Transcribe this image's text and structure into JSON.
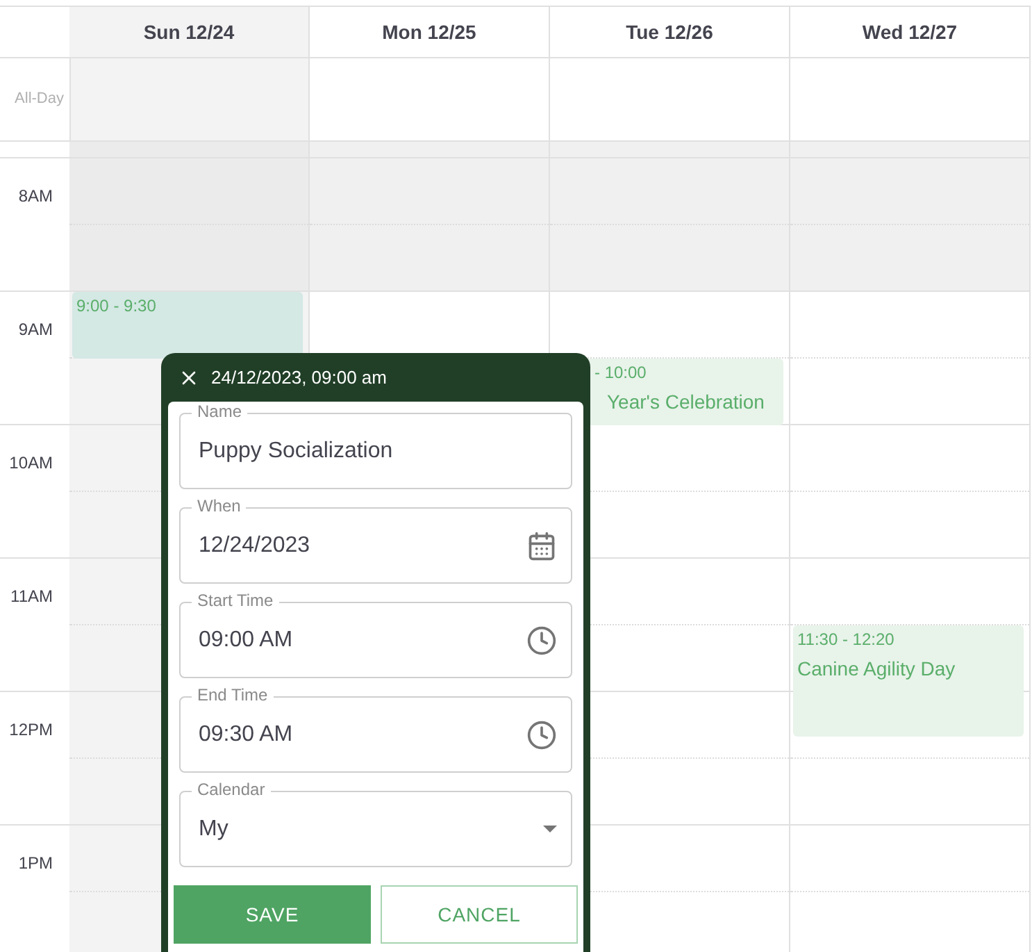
{
  "all_day_label": "All-Day",
  "days": [
    {
      "label": "Sun 12/24",
      "selected": true,
      "events": [
        {
          "time": "9:00 - 9:30",
          "color": "#d4e8e4"
        }
      ]
    },
    {
      "label": "Mon 12/25",
      "selected": false
    },
    {
      "label": "Tue 12/26",
      "selected": false,
      "events": [
        {
          "time": "- 10:00",
          "title": "Year's Celebration",
          "color": "#e8f3ea"
        }
      ]
    },
    {
      "label": "Wed 12/27",
      "selected": false,
      "events": [
        {
          "time": "11:30 - 12:20",
          "title": "Canine Agility Day",
          "color": "#e8f3ea"
        }
      ]
    }
  ],
  "hours": [
    {
      "label": "8AM",
      "off_hours": true
    },
    {
      "label": "9AM",
      "off_hours": false
    },
    {
      "label": "10AM",
      "off_hours": false
    },
    {
      "label": "11AM",
      "off_hours": false
    },
    {
      "label": "12PM",
      "off_hours": false
    },
    {
      "label": "1PM",
      "off_hours": false
    }
  ],
  "popup": {
    "title": "24/12/2023, 09:00 am",
    "fields": [
      {
        "kind": "text",
        "label": "Name",
        "value": "Puppy Socialization"
      },
      {
        "kind": "date",
        "label": "When",
        "value": "12/24/2023"
      },
      {
        "kind": "time",
        "label": "Start Time",
        "value": "09:00 AM"
      },
      {
        "kind": "time",
        "label": "End Time",
        "value": "09:30 AM"
      },
      {
        "kind": "select",
        "label": "Calendar",
        "value": "My"
      }
    ],
    "buttons": [
      {
        "kind": "primary",
        "label": "SAVE"
      },
      {
        "kind": "outline",
        "label": "CANCEL"
      }
    ]
  }
}
